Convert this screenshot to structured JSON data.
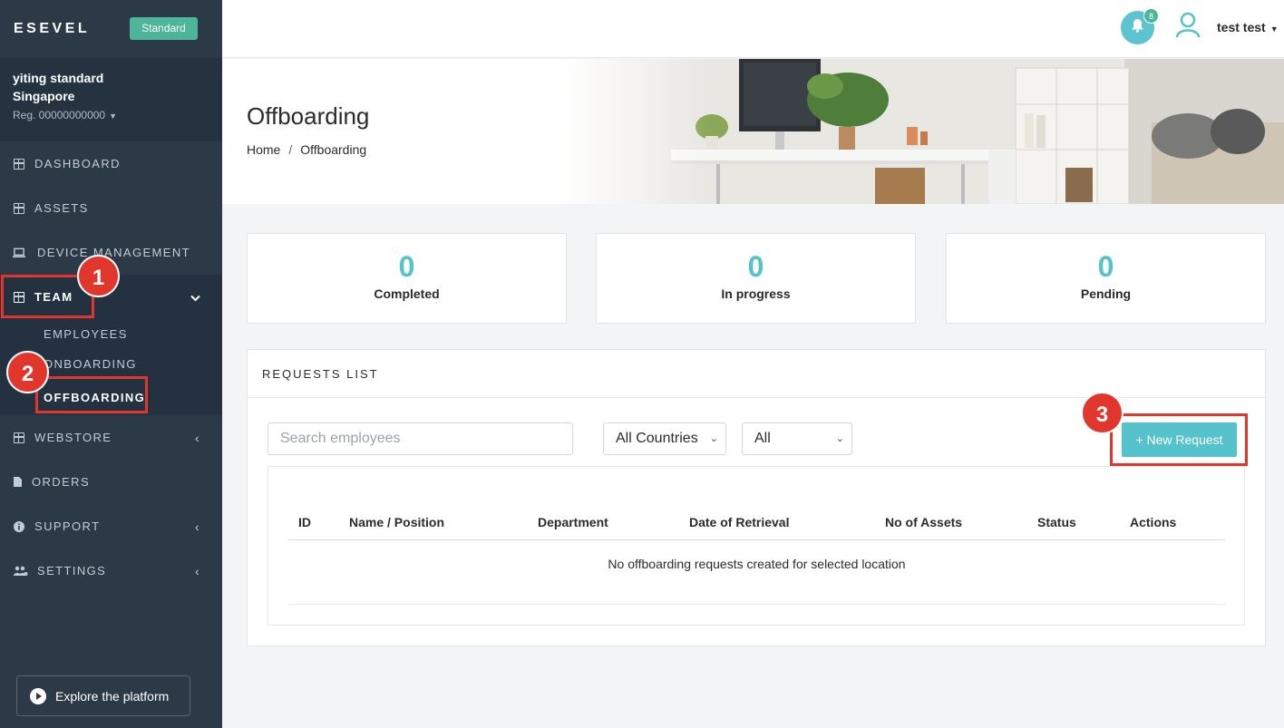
{
  "sidebar": {
    "logo": "ESEVEL",
    "plan_badge": "Standard",
    "org_name_line1": "yiting standard",
    "org_name_line2": "Singapore",
    "org_reg": "Reg. 00000000000",
    "nav": {
      "dashboard": "DASHBOARD",
      "assets": "ASSETS",
      "device_management": "DEVICE MANAGEMENT",
      "team": "TEAM",
      "employees": "EMPLOYEES",
      "onboarding": "ONBOARDING",
      "offboarding": "OFFBOARDING",
      "webstore": "WEBSTORE",
      "orders": "ORDERS",
      "support": "SUPPORT",
      "settings": "SETTINGS"
    },
    "explore_label": "Explore the platform"
  },
  "topbar": {
    "notification_count": "8",
    "user_name": "test test"
  },
  "hero": {
    "title": "Offboarding",
    "breadcrumb_home": "Home",
    "breadcrumb_separator": "/",
    "breadcrumb_current": "Offboarding"
  },
  "stats": [
    {
      "value": "0",
      "label": "Completed"
    },
    {
      "value": "0",
      "label": "In progress"
    },
    {
      "value": "0",
      "label": "Pending"
    }
  ],
  "requests": {
    "title": "REQUESTS LIST",
    "search_placeholder": "Search employees",
    "country_filter": "All Countries",
    "status_filter": "All",
    "new_request_label": "+ New Request",
    "columns": [
      "ID",
      "Name / Position",
      "Department",
      "Date of Retrieval",
      "No of Assets",
      "Status",
      "Actions"
    ],
    "empty_message": "No offboarding requests created for selected location"
  },
  "annotations": [
    "1",
    "2",
    "3"
  ],
  "colors": {
    "accent": "#55c2cc",
    "sidebar_bg": "#2c3a48",
    "badge_green": "#4cb59a",
    "annotation_red": "#e0362c"
  }
}
